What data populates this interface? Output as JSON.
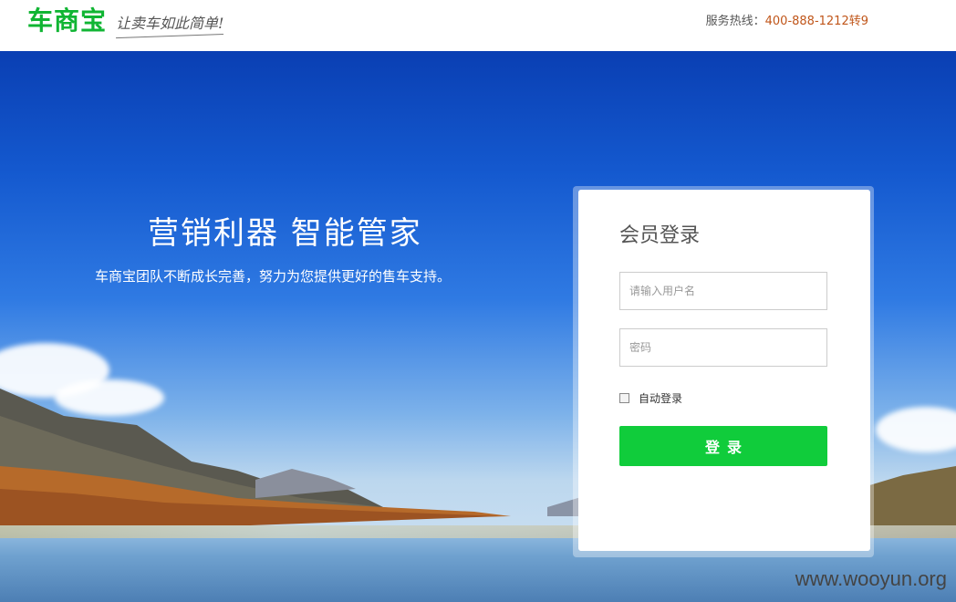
{
  "header": {
    "logo_text": "车商宝",
    "tagline": "让卖车如此简单!",
    "hotline_label": "服务热线：",
    "hotline_number": "400-888-1212转9"
  },
  "hero": {
    "title": "营销利器  智能管家",
    "subtitle": "车商宝团队不断成长完善，努力为您提供更好的售车支持。"
  },
  "login": {
    "title": "会员登录",
    "username_placeholder": "请输入用户名",
    "username_value": "",
    "password_placeholder": "密码",
    "password_value": "",
    "remember_label": "自动登录",
    "remember_checked": false,
    "submit_label": "登录"
  },
  "watermark": "www.wooyun.org",
  "colors": {
    "brand_green": "#10b533",
    "button_green": "#10cc3b",
    "hotline_orange": "#c0561a"
  }
}
